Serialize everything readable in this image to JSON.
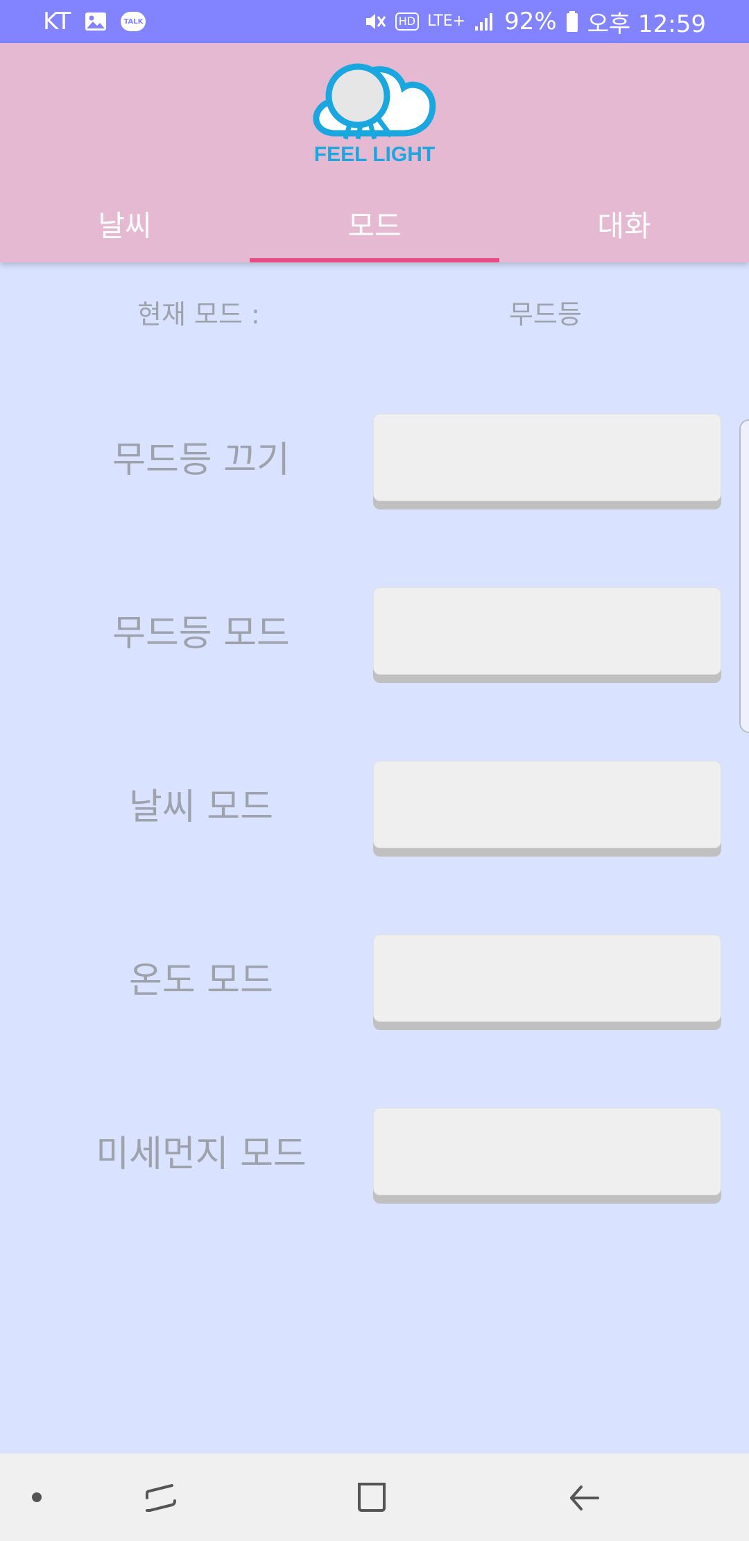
{
  "status_bar": {
    "carrier": "KT",
    "talk_label": "TALK",
    "hd_label": "HD",
    "network": "LTE+",
    "battery": "92%",
    "time": "오후 12:59",
    "icons": [
      "image-icon",
      "kakaotalk-icon",
      "mute-icon",
      "hd-voice-icon",
      "lte-icon",
      "signal-icon",
      "battery-icon"
    ]
  },
  "header": {
    "logo_text": "FEEL LIGHT",
    "tabs": [
      {
        "label": "날씨",
        "active": false
      },
      {
        "label": "모드",
        "active": true
      },
      {
        "label": "대화",
        "active": false
      }
    ],
    "tab_indicator_color": "#e84a83",
    "background": "#e6b9d3"
  },
  "main": {
    "current_mode_label": "현재 모드 :",
    "current_mode_value": "무드등",
    "modes": [
      {
        "label": "무드등 끄기"
      },
      {
        "label": "무드등 모드"
      },
      {
        "label": "날씨 모드"
      },
      {
        "label": "온도 모드"
      },
      {
        "label": "미세먼지 모드"
      }
    ],
    "background": "#d9e2ff"
  },
  "nav_bar": {
    "items": [
      "dot-icon",
      "recent-apps-icon",
      "home-icon",
      "back-icon"
    ]
  }
}
